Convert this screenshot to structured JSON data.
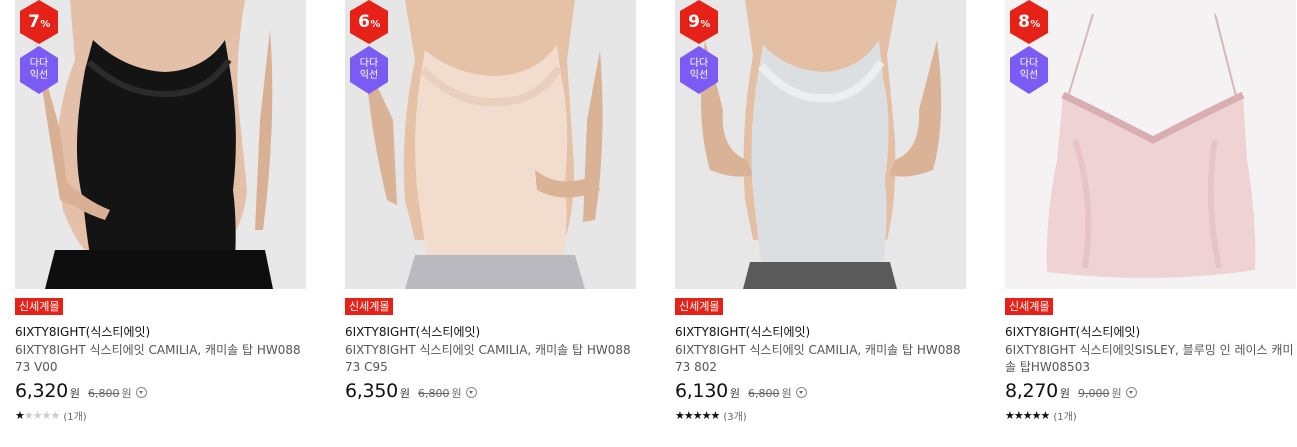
{
  "colors": {
    "discount_red": "#e62117",
    "dada_purple": "#7a5cf5",
    "badge_red": "#e62117"
  },
  "products": [
    {
      "discount_value": "7",
      "discount_unit": "%",
      "dada_label": "다다익선",
      "badge": "신세계몰",
      "brand": "6IXTY8IGHT(식스티에잇)",
      "name": "6IXTY8IGHT 식스티에잇 CAMILIA, 캐미솔 탑 HW08873 V00",
      "price": "6,320",
      "price_unit": "원",
      "original_price": "6,800",
      "original_unit": "원",
      "rating": 1,
      "rating_max": 5,
      "review_count": "(1개)",
      "image_subject": "black-camisole"
    },
    {
      "discount_value": "6",
      "discount_unit": "%",
      "dada_label": "다다익선",
      "badge": "신세계몰",
      "brand": "6IXTY8IGHT(식스티에잇)",
      "name": "6IXTY8IGHT 식스티에잇 CAMILIA, 캐미솔 탑 HW08873 C95",
      "price": "6,350",
      "price_unit": "원",
      "original_price": "6,800",
      "original_unit": "원",
      "rating": null,
      "rating_max": 5,
      "review_count": "",
      "image_subject": "beige-camisole"
    },
    {
      "discount_value": "9",
      "discount_unit": "%",
      "dada_label": "다다익선",
      "badge": "신세계몰",
      "brand": "6IXTY8IGHT(식스티에잇)",
      "name": "6IXTY8IGHT 식스티에잇 CAMILIA, 캐미솔 탑 HW08873 802",
      "price": "6,130",
      "price_unit": "원",
      "original_price": "6,800",
      "original_unit": "원",
      "rating": 5,
      "rating_max": 5,
      "review_count": "(3개)",
      "image_subject": "grey-camisole"
    },
    {
      "discount_value": "8",
      "discount_unit": "%",
      "dada_label": "다다익선",
      "badge": "신세계몰",
      "brand": "6IXTY8IGHT(식스티에잇)",
      "name": "6IXTY8IGHT 식스티에잇SISLEY, 블루밍 인 레이스 캐미솔 탑HW08503",
      "price": "8,270",
      "price_unit": "원",
      "original_price": "9,000",
      "original_unit": "원",
      "rating": 5,
      "rating_max": 5,
      "review_count": "(1개)",
      "image_subject": "pink-satin-camisole"
    }
  ]
}
